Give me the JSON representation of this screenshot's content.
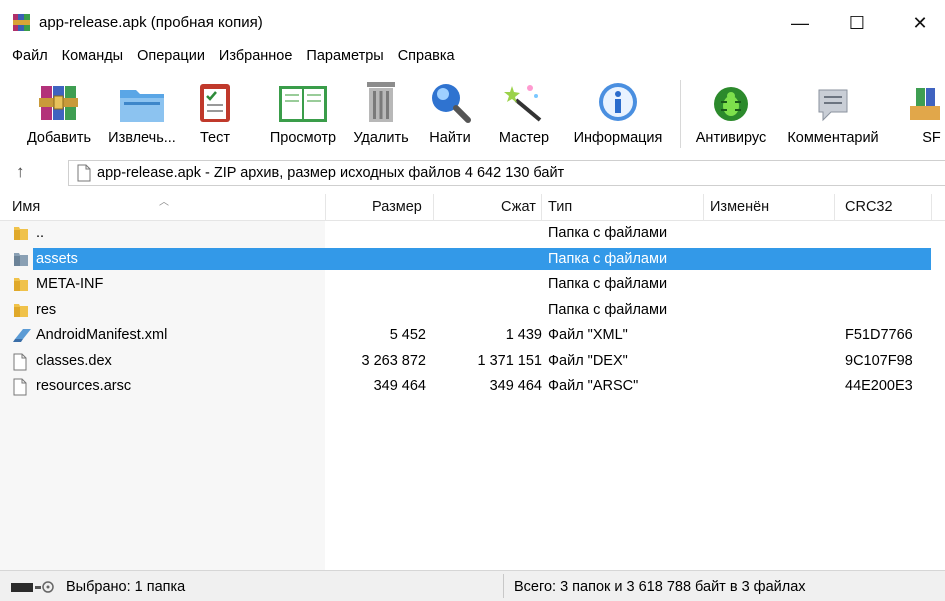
{
  "window": {
    "title": "app-release.apk (пробная копия)",
    "minimize": "—",
    "maximize": "☐",
    "close": "✕"
  },
  "menu": [
    "Файл",
    "Команды",
    "Операции",
    "Избранное",
    "Параметры",
    "Справка"
  ],
  "toolbar": {
    "add": "Добавить",
    "extract": "Извлечь...",
    "test": "Тест",
    "view": "Просмотр",
    "delete": "Удалить",
    "find": "Найти",
    "wizard": "Мастер",
    "info": "Информация",
    "antivirus": "Антивирус",
    "comment": "Комментарий",
    "sfx": "SF"
  },
  "address": {
    "up": "↑",
    "text": "app-release.apk - ZIP архив, размер исходных файлов 4 642 130 байт"
  },
  "columns": {
    "name": "Имя",
    "size": "Размер",
    "packed": "Сжат",
    "type": "Тип",
    "modified": "Изменён",
    "crc": "CRC32"
  },
  "rows": [
    {
      "name": "..",
      "size": "",
      "packed": "",
      "type": "Папка с файлами",
      "crc": "",
      "icon": "folder-icon"
    },
    {
      "name": "assets",
      "size": "",
      "packed": "",
      "type": "Папка с файлами",
      "crc": "",
      "icon": "folder-icon"
    },
    {
      "name": "META-INF",
      "size": "",
      "packed": "",
      "type": "Папка с файлами",
      "crc": "",
      "icon": "folder-icon"
    },
    {
      "name": "res",
      "size": "",
      "packed": "",
      "type": "Папка с файлами",
      "crc": "",
      "icon": "folder-icon"
    },
    {
      "name": "AndroidManifest.xml",
      "size": "5 452",
      "packed": "1 439",
      "type": "Файл \"XML\"",
      "crc": "F51D7766",
      "icon": "xml-file-icon"
    },
    {
      "name": "classes.dex",
      "size": "3 263 872",
      "packed": "1 371 151",
      "type": "Файл \"DEX\"",
      "crc": "9C107F98",
      "icon": "file-icon"
    },
    {
      "name": "resources.arsc",
      "size": "349 464",
      "packed": "349 464",
      "type": "Файл \"ARSC\"",
      "crc": "44E200E3",
      "icon": "file-icon"
    }
  ],
  "status": {
    "selected": "Выбрано: 1 папка",
    "total": "Всего: 3 папок и 3 618 788 байт в 3 файлах"
  },
  "colors": {
    "selection": "#3399e8"
  }
}
